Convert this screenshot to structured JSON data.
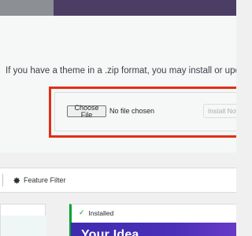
{
  "upload": {
    "help_text": "If you have a theme in a .zip format, you may install or update it by uploading it here.",
    "choose_file_label": "Choose File",
    "file_status": "No file chosen",
    "install_label": "Install Now"
  },
  "filter_bar": {
    "feature_filter_label": "Feature Filter",
    "icon": "gear-icon"
  },
  "theme_card": {
    "status_label": "Installed",
    "status_icon": "check-icon",
    "preview_heading": "Your Idea"
  },
  "colors": {
    "admin_bar": "#4b3d63",
    "highlight": "#e32e17",
    "installed_accent": "#00a32a",
    "preview_gradient_start": "#3f2bb0"
  }
}
